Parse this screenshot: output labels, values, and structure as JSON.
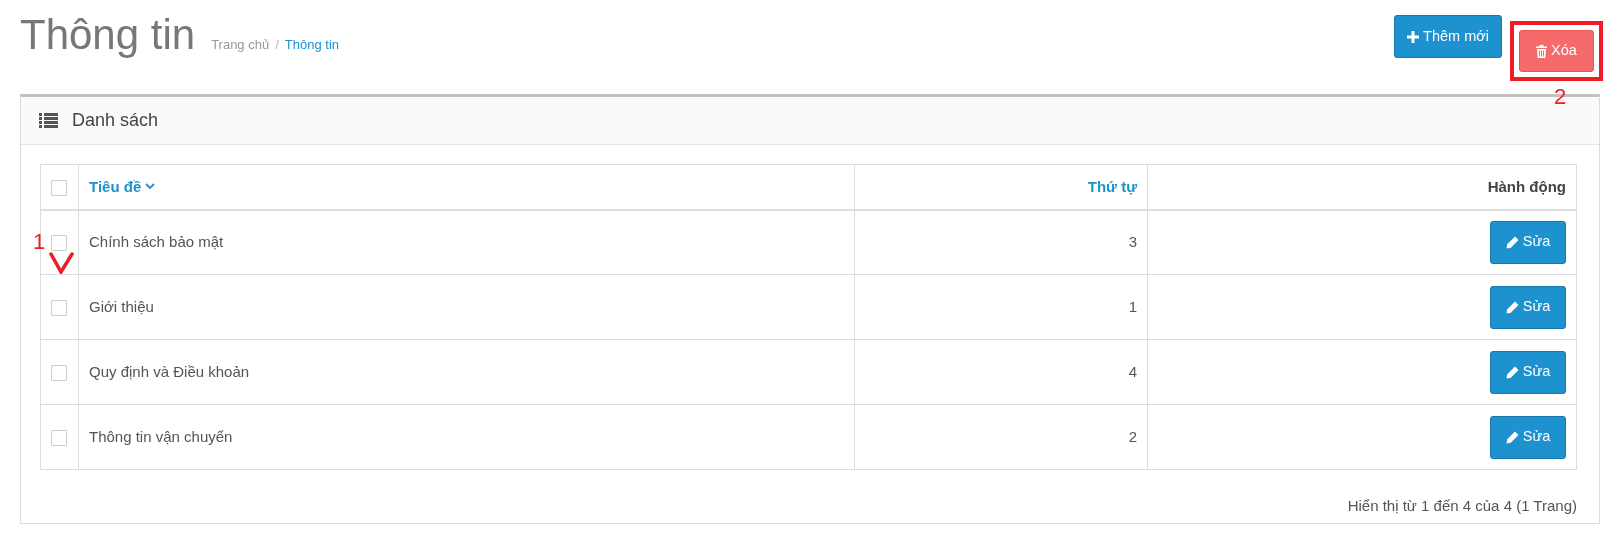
{
  "page": {
    "title": "Thông tin",
    "breadcrumb": [
      {
        "label": "Trang chủ",
        "current": false
      },
      {
        "label": "Thông tin",
        "current": true
      }
    ],
    "separator": "/"
  },
  "actions": [
    {
      "label": "Thêm mới",
      "kind": "add"
    },
    {
      "label": "Xóa",
      "kind": "delete"
    }
  ],
  "panel": {
    "title": "Danh sách"
  },
  "table": {
    "select_all": {
      "checked": false
    },
    "columns": [
      {
        "label": "Tiêu đề",
        "sortable": true,
        "sorted": true
      },
      {
        "label": "Thứ tự",
        "sortable": true,
        "sorted": false
      },
      {
        "label": "Hành động",
        "sortable": false,
        "sorted": false
      }
    ],
    "rows": [
      {
        "checked": false,
        "title": "Chính sách bảo mật",
        "order": "3",
        "action": "Sửa"
      },
      {
        "checked": false,
        "title": "Giới thiệu",
        "order": "1",
        "action": "Sửa"
      },
      {
        "checked": false,
        "title": "Quy định và Điều khoản",
        "order": "4",
        "action": "Sửa"
      },
      {
        "checked": false,
        "title": "Thông tin vận chuyển",
        "order": "2",
        "action": "Sửa"
      }
    ]
  },
  "footer": "Hiển thị từ 1 đến 4 của 4 (1 Trang)",
  "annotations": [
    {
      "label": "1",
      "kind": "check"
    },
    {
      "label": "2",
      "kind": "box"
    }
  ]
}
